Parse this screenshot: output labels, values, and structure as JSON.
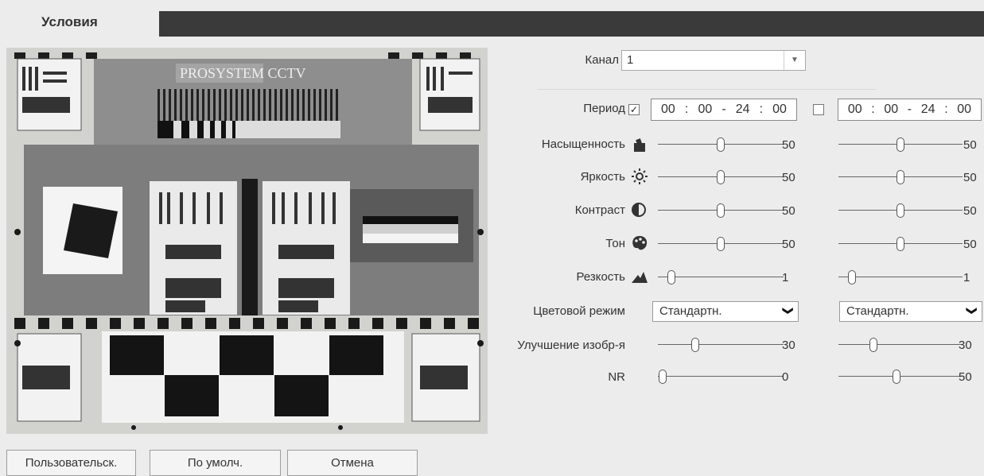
{
  "tab": {
    "label": "Условия"
  },
  "preview": {
    "logo_text": "PROSYSTEM CCTV"
  },
  "channel": {
    "label": "Канал",
    "value": "1"
  },
  "period": {
    "label": "Период",
    "schedules": [
      {
        "checked": true,
        "h1": "00",
        "m1": "00",
        "h2": "24",
        "m2": "00"
      },
      {
        "checked": false,
        "h1": "00",
        "m1": "00",
        "h2": "24",
        "m2": "00"
      }
    ]
  },
  "rows": [
    {
      "key": "saturation",
      "label": "Насыщенность",
      "icon": "saturation-icon",
      "values": [
        "50",
        "50"
      ]
    },
    {
      "key": "brightness",
      "label": "Яркость",
      "icon": "brightness-icon",
      "values": [
        "50",
        "50"
      ]
    },
    {
      "key": "contrast",
      "label": "Контраст",
      "icon": "contrast-icon",
      "values": [
        "50",
        "50"
      ]
    },
    {
      "key": "hue",
      "label": "Тон",
      "icon": "hue-icon",
      "values": [
        "50",
        "50"
      ]
    },
    {
      "key": "sharpness",
      "label": "Резкость",
      "icon": "sharpness-icon",
      "values": [
        "1",
        "1"
      ]
    }
  ],
  "color_mode": {
    "label": "Цветовой режим",
    "values": [
      "Стандартн.",
      "Стандартн."
    ]
  },
  "enhance": {
    "label": "Улучшение изобр-я",
    "values": [
      "30",
      "30"
    ]
  },
  "nr": {
    "label": "NR",
    "values": [
      "0",
      "50"
    ]
  },
  "buttons": {
    "custom": "Пользовательск.",
    "default": "По умолч.",
    "cancel": "Отмена"
  }
}
